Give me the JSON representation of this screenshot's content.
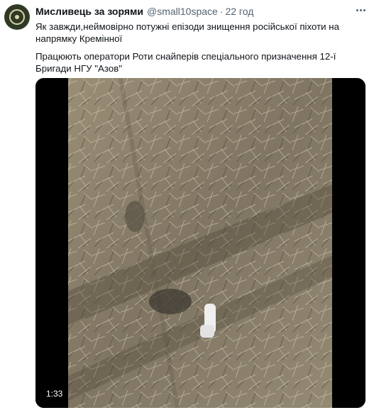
{
  "tweet": {
    "author_name": "Мисливець за зорями",
    "handle": "@small10space",
    "separator": "·",
    "time": "22 год",
    "text_line1": "Як завжди,неймовірно потужні епізоди знищення російської піхоти на напрямку Кремінної",
    "text_line2": "Працюють оператори Роти снайперів спеціального призначення 12-ї Бригади НГУ \"Азов\""
  },
  "video": {
    "duration": "1:33"
  },
  "icons": {
    "more": "more-horizontal-icon",
    "avatar": "profile-avatar"
  },
  "colors": {
    "text": "#0f1419",
    "secondary": "#536471",
    "video_ground": "#8a7f69"
  }
}
